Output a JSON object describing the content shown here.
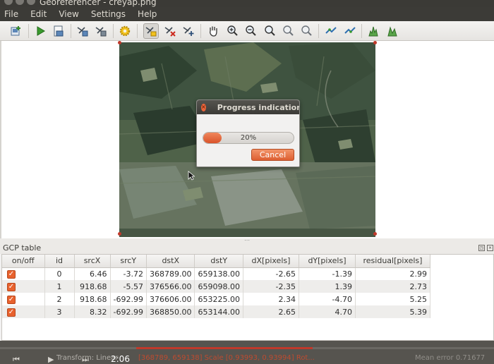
{
  "window": {
    "title": "Georeferencer - creyap.png"
  },
  "menu": {
    "items": [
      "File",
      "Edit",
      "View",
      "Settings",
      "Help"
    ]
  },
  "toolbar": {
    "icons": [
      "open-raster-icon",
      "start-georeferencing-icon",
      "generate-script-icon",
      "load-gcp-icon",
      "save-gcp-icon",
      "transformation-settings-icon",
      "add-point-icon",
      "delete-point-icon",
      "move-gcp-icon",
      "pan-icon",
      "zoom-in-icon",
      "zoom-out-icon",
      "zoom-to-layer-icon",
      "zoom-last-icon",
      "zoom-next-icon",
      "link-georeferencer-to-qgis-icon",
      "link-qgis-to-georeferencer-icon",
      "full-histogram-stretch-icon",
      "local-histogram-stretch-icon"
    ],
    "active_icon": "add-point-icon"
  },
  "dialog": {
    "title": "Progress indication",
    "progress_value": 20,
    "progress_label": "20%",
    "cancel_label": "Cancel"
  },
  "gcp_panel": {
    "title": "GCP table",
    "columns": [
      "on/off",
      "id",
      "srcX",
      "srcY",
      "dstX",
      "dstY",
      "dX[pixels]",
      "dY[pixels]",
      "residual[pixels]"
    ],
    "rows": [
      {
        "enabled": true,
        "id": "0",
        "srcX": "6.46",
        "srcY": "-3.72",
        "dstX": "368789.00",
        "dstY": "659138.00",
        "dX": "-2.65",
        "dY": "-1.39",
        "residual": "2.99"
      },
      {
        "enabled": true,
        "id": "1",
        "srcX": "918.68",
        "srcY": "-5.57",
        "dstX": "376566.00",
        "dstY": "659098.00",
        "dX": "-2.35",
        "dY": "1.39",
        "residual": "2.73"
      },
      {
        "enabled": true,
        "id": "2",
        "srcX": "918.68",
        "srcY": "-692.99",
        "dstX": "376606.00",
        "dstY": "653225.00",
        "dX": "2.34",
        "dY": "-4.70",
        "residual": "5.25"
      },
      {
        "enabled": true,
        "id": "3",
        "srcX": "8.32",
        "srcY": "-692.99",
        "dstX": "368850.00",
        "dstY": "653144.00",
        "dX": "2.65",
        "dY": "4.70",
        "residual": "5.39"
      }
    ]
  },
  "status_bar": {
    "text_left": "Transform: Linear",
    "time": "2:06",
    "text_coords": "[368789, 659138] Scale [0.93993, 0.93994] Rot...",
    "text_right": "Mean error 0.71677"
  },
  "colors": {
    "accent": "#e9643a",
    "menubar": "#3c3b37",
    "panel": "#f2f1f0"
  }
}
